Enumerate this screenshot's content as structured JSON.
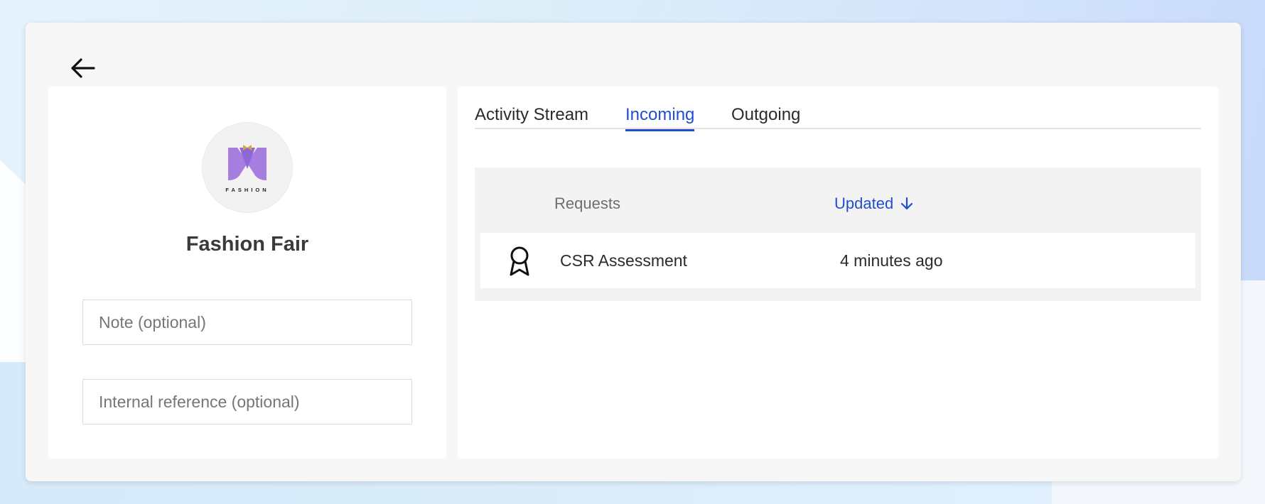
{
  "page": {
    "back_label": "Back",
    "colors": {
      "accent": "#1f4fd1",
      "logo_purple": "#a57ee0",
      "logo_gold": "#d4a53c"
    }
  },
  "profile": {
    "company_name": "Fashion Fair",
    "logo_text": "FASHION",
    "note_placeholder": "Note (optional)",
    "reference_placeholder": "Internal reference (optional)"
  },
  "tabs": [
    {
      "label": "Activity Stream",
      "active": false
    },
    {
      "label": "Incoming",
      "active": true
    },
    {
      "label": "Outgoing",
      "active": false
    }
  ],
  "table": {
    "columns": {
      "requests": "Requests",
      "updated": "Updated",
      "sort_icon": "arrow-down-icon"
    },
    "rows": [
      {
        "icon": "award-ribbon-icon",
        "name": "CSR Assessment",
        "updated": "4 minutes ago"
      }
    ]
  }
}
